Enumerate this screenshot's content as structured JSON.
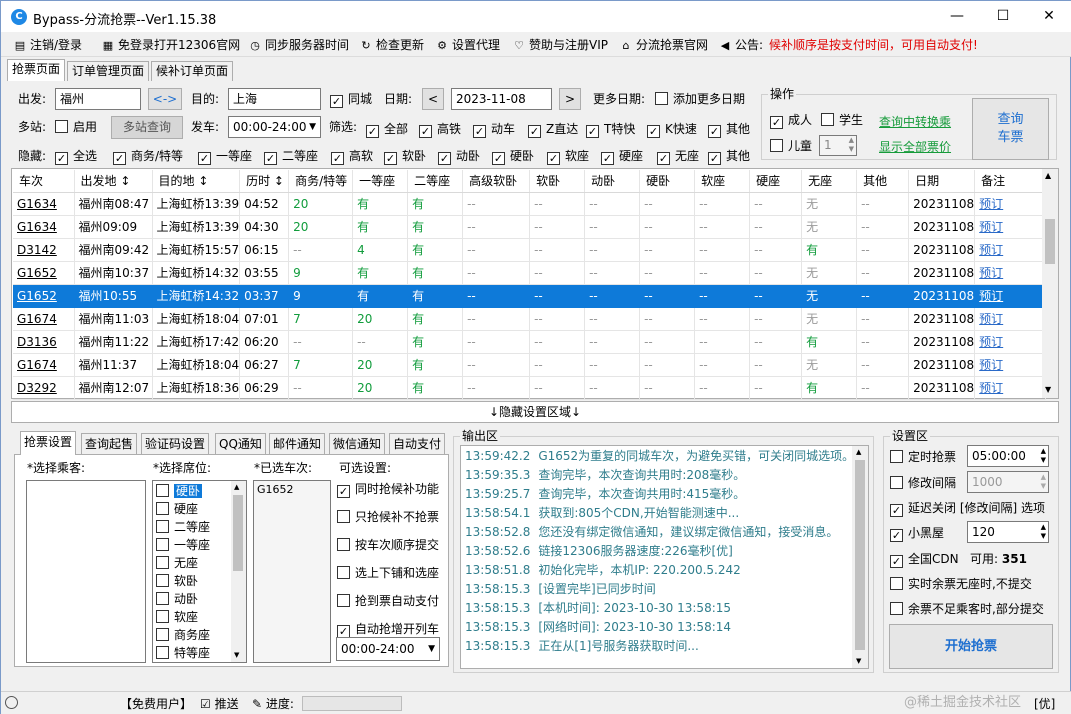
{
  "window": {
    "title": "Bypass-分流抢票--Ver1.15.38",
    "icon_letter": "C",
    "minimize": "—",
    "maximize": "☐",
    "close": "✕"
  },
  "menu": [
    {
      "label": "注销/登录",
      "icon": "login-icon",
      "glyph": "▤"
    },
    {
      "label": "免登录打开12306官网",
      "icon": "browser-icon",
      "glyph": "▦"
    },
    {
      "label": "同步服务器时间",
      "icon": "clock-icon",
      "glyph": "◷"
    },
    {
      "label": "检查更新",
      "icon": "refresh-icon",
      "glyph": "↻"
    },
    {
      "label": "设置代理",
      "icon": "gear-icon",
      "glyph": "⚙"
    },
    {
      "label": "赞助与注册VIP",
      "icon": "heart-icon",
      "glyph": "♡"
    },
    {
      "label": "分流抢票官网",
      "icon": "home-icon",
      "glyph": "⌂"
    },
    {
      "label": "公告:",
      "icon": "speaker-icon",
      "glyph": "◀"
    }
  ],
  "notice": "候补顺序是按支付时间，可用自动支付!",
  "main_tabs": [
    "抢票页面",
    "订单管理页面",
    "候补订单页面"
  ],
  "search": {
    "from_label": "出发:",
    "from_value": "福州",
    "swap_label": "<->",
    "to_label": "目的:",
    "to_value": "上海",
    "same_city_label": "同城",
    "same_city_checked": true,
    "date_label": "日期:",
    "date_value": "2023-11-08",
    "date_prev": "<",
    "date_next": ">",
    "more_dates_label": "更多日期:",
    "add_dates_label": "添加更多日期",
    "add_dates_checked": false,
    "multi_label": "多站:",
    "multi_enable_label": "启用",
    "multi_query_label": "多站查询",
    "depart_label": "发车:",
    "depart_value": "00:00-24:00",
    "filter_label": "筛选:",
    "filters": [
      {
        "label": "全部",
        "checked": true
      },
      {
        "label": "高铁",
        "checked": true
      },
      {
        "label": "动车",
        "checked": true
      },
      {
        "label": "Z直达",
        "checked": true
      },
      {
        "label": "T特快",
        "checked": true
      },
      {
        "label": "K快速",
        "checked": true
      },
      {
        "label": "其他",
        "checked": true
      }
    ],
    "hide_label": "隐藏:",
    "hides": [
      {
        "label": "全选",
        "checked": true
      },
      {
        "label": "商务/特等",
        "checked": true
      },
      {
        "label": "一等座",
        "checked": true
      },
      {
        "label": "二等座",
        "checked": true
      },
      {
        "label": "高软",
        "checked": true
      },
      {
        "label": "软卧",
        "checked": true
      },
      {
        "label": "动卧",
        "checked": true
      },
      {
        "label": "硬卧",
        "checked": true
      },
      {
        "label": "软座",
        "checked": true
      },
      {
        "label": "硬座",
        "checked": true
      },
      {
        "label": "无座",
        "checked": true
      },
      {
        "label": "其他",
        "checked": true
      }
    ]
  },
  "ops": {
    "title": "操作",
    "adult": "成人",
    "adult_checked": true,
    "student": "学生",
    "student_checked": false,
    "child": "儿童",
    "child_checked": false,
    "child_count": "1",
    "transfer_link": "查询中转换乘",
    "show_all_link": "显示全部票价",
    "query_line1": "查询",
    "query_line2": "车票"
  },
  "table": {
    "headers": [
      "车次",
      "出发地 ↕",
      "目的地 ↕",
      "历时 ↕",
      "商务/特等",
      "一等座",
      "二等座",
      "高级软卧",
      "软卧",
      "动卧",
      "硬卧",
      "软座",
      "硬座",
      "无座",
      "其他",
      "日期",
      "备注"
    ],
    "rows": [
      [
        "G1634",
        "福州南08:47",
        "上海虹桥13:39",
        "04:52",
        "20",
        "有",
        "有",
        "--",
        "--",
        "--",
        "--",
        "--",
        "--",
        "无",
        "--",
        "20231108",
        "预订"
      ],
      [
        "G1634",
        "福州09:09",
        "上海虹桥13:39",
        "04:30",
        "20",
        "有",
        "有",
        "--",
        "--",
        "--",
        "--",
        "--",
        "--",
        "无",
        "--",
        "20231108",
        "预订"
      ],
      [
        "D3142",
        "福州南09:42",
        "上海虹桥15:57",
        "06:15",
        "--",
        "4",
        "有",
        "--",
        "--",
        "--",
        "--",
        "--",
        "--",
        "有",
        "--",
        "20231108",
        "预订"
      ],
      [
        "G1652",
        "福州南10:37",
        "上海虹桥14:32",
        "03:55",
        "9",
        "有",
        "有",
        "--",
        "--",
        "--",
        "--",
        "--",
        "--",
        "无",
        "--",
        "20231108",
        "预订"
      ],
      [
        "G1652",
        "福州10:55",
        "上海虹桥14:32",
        "03:37",
        "9",
        "有",
        "有",
        "--",
        "--",
        "--",
        "--",
        "--",
        "--",
        "无",
        "--",
        "20231108",
        "预订"
      ],
      [
        "G1674",
        "福州南11:03",
        "上海虹桥18:04",
        "07:01",
        "7",
        "20",
        "有",
        "--",
        "--",
        "--",
        "--",
        "--",
        "--",
        "无",
        "--",
        "20231108",
        "预订"
      ],
      [
        "D3136",
        "福州南11:22",
        "上海虹桥17:42",
        "06:20",
        "--",
        "--",
        "有",
        "--",
        "--",
        "--",
        "--",
        "--",
        "--",
        "有",
        "--",
        "20231108",
        "预订"
      ],
      [
        "G1674",
        "福州11:37",
        "上海虹桥18:04",
        "06:27",
        "7",
        "20",
        "有",
        "--",
        "--",
        "--",
        "--",
        "--",
        "--",
        "无",
        "--",
        "20231108",
        "预订"
      ],
      [
        "D3292",
        "福州南12:07",
        "上海虹桥18:36",
        "06:29",
        "--",
        "20",
        "有",
        "--",
        "--",
        "--",
        "--",
        "--",
        "--",
        "有",
        "--",
        "20231108",
        "预订"
      ]
    ],
    "selected_row": 4
  },
  "hide_settings_label": "↓隐藏设置区域↓",
  "sub_tabs": [
    "抢票设置",
    "查询起售",
    "验证码设置",
    "QQ通知",
    "邮件通知",
    "微信通知",
    "自动支付"
  ],
  "settings": {
    "passenger_label": "*选择乘客:",
    "seat_label": "*选择席位:",
    "seats": [
      "硬卧",
      "硬座",
      "二等座",
      "一等座",
      "无座",
      "软卧",
      "动卧",
      "软座",
      "商务座",
      "特等座"
    ],
    "selected_trains_label": "*已选车次:",
    "selected_trains": [
      "G1652"
    ],
    "options_label": "可选设置:",
    "options": [
      {
        "label": "同时抢候补功能",
        "checked": true
      },
      {
        "label": "只抢候补不抢票",
        "checked": false
      },
      {
        "label": "按车次顺序提交",
        "checked": false
      },
      {
        "label": "选上下铺和选座",
        "checked": false
      },
      {
        "label": "抢到票自动支付",
        "checked": false
      },
      {
        "label": "自动抢增开列车",
        "checked": true
      }
    ],
    "time_range": "00:00-24:00"
  },
  "output": {
    "title": "输出区",
    "lines": [
      {
        "time": "13:59:42.2",
        "text": "G1652为重复的同城车次，为避免买错，可关闭同城选项。"
      },
      {
        "time": "13:59:35.3",
        "text": "查询完毕，本次查询共用时:208毫秒。"
      },
      {
        "time": "13:59:25.7",
        "text": "查询完毕，本次查询共用时:415毫秒。"
      },
      {
        "time": "13:58:54.1",
        "text": "获取到:805个CDN,开始智能测速中..."
      },
      {
        "time": "13:58:52.8",
        "text": "您还没有绑定微信通知，建议绑定微信通知，接受消息。"
      },
      {
        "time": "13:58:52.6",
        "text": "链接12306服务器速度:226毫秒[优]"
      },
      {
        "time": "13:58:51.8",
        "text": "初始化完毕，本机IP: 220.200.5.242"
      },
      {
        "time": "13:58:15.3",
        "text": "[设置完毕]已同步时间"
      },
      {
        "time": "13:58:15.3",
        "text": "[本机时间]: 2023-10-30 13:58:15"
      },
      {
        "time": "13:58:15.3",
        "text": "[网络时间]: 2023-10-30 13:58:14"
      },
      {
        "time": "13:58:15.3",
        "text": "正在从[1]号服务器获取时间..."
      }
    ]
  },
  "setting_area": {
    "title": "设置区",
    "timed_label": "定时抢票",
    "timed_checked": false,
    "timed_value": "05:00:00",
    "interval_label": "修改间隔",
    "interval_checked": false,
    "interval_value": "1000",
    "delay_label": "延迟关闭 [修改间隔] 选项",
    "delay_checked": true,
    "blackroom_label": "小黑屋",
    "blackroom_checked": true,
    "blackroom_value": "120",
    "cdn_label": "全国CDN",
    "cdn_checked": true,
    "cdn_avail_label": "可用:",
    "cdn_avail_value": "351",
    "no_seat_label": "实时余票无座时,不提交",
    "no_seat_checked": false,
    "partial_label": "余票不足乘客时,部分提交",
    "partial_checked": false,
    "start_label": "开始抢票"
  },
  "status": {
    "user": "【免费用户】",
    "push": "推送",
    "progress_label": "进度:",
    "progress_value": 0,
    "watermark": "@稀土掘金技术社区",
    "right": "[优]"
  }
}
